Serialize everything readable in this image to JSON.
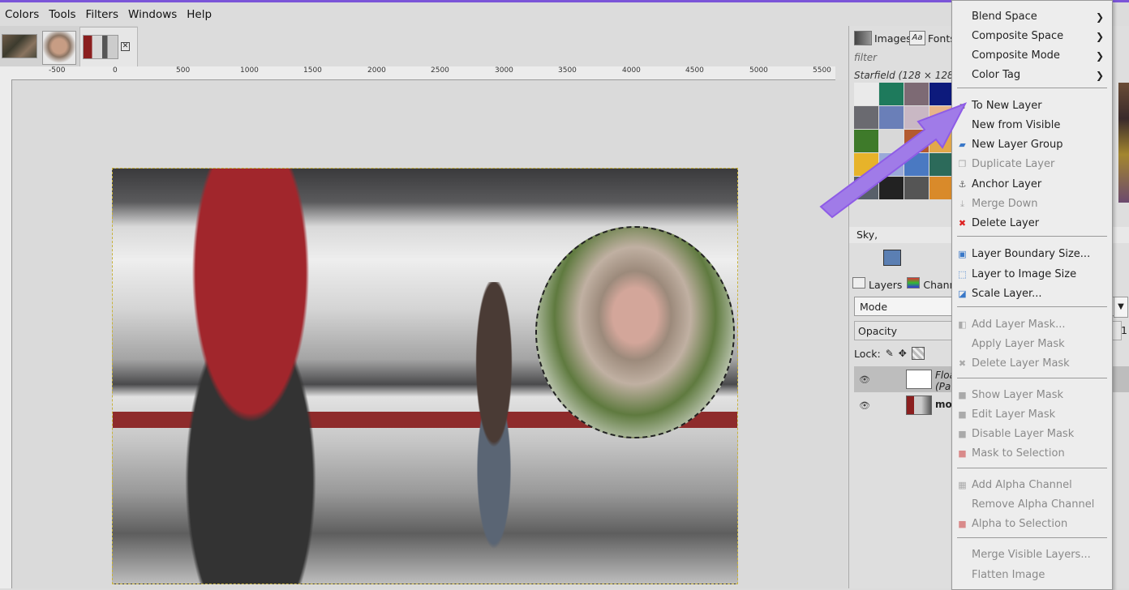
{
  "menubar": {
    "items": [
      "Colors",
      "Tools",
      "Filters",
      "Windows",
      "Help"
    ]
  },
  "image_tabs": {
    "close_glyph": "✕"
  },
  "ruler": {
    "h_labels": [
      "-500",
      "0",
      "500",
      "1000",
      "1500",
      "2000",
      "2500",
      "3000",
      "3500",
      "4000",
      "4500",
      "5000",
      "5500"
    ]
  },
  "dock": {
    "tabs": {
      "images": "Images",
      "fonts": "Fonts",
      "fonts_icon_glyph": "Aa"
    },
    "filter_placeholder": "filter",
    "pattern_name": "Starfield (128 × 128)",
    "pattern_colors": [
      "#eaeaea",
      "#1e7a5c",
      "#7d6a74",
      "#0d1a7c",
      "#6a6a70",
      "#6a7fb8",
      "#c9b8c4",
      "#e7b48a",
      "#3e7a2a",
      "#d8d8d8",
      "#b35a2f",
      "#e2a84a",
      "#e7b32a",
      "#9aa9d8",
      "#4a79c2",
      "#2c6a5a",
      "#58606a",
      "#222222",
      "#555555",
      "#d98a2a"
    ],
    "brush_name": "Sky,",
    "layers_tab": "Layers",
    "channels_tab": "Channe",
    "mode_label": "Mode",
    "opacity_label": "Opacity",
    "opacity_value": "1",
    "lock_label": "Lock:",
    "layer1_name_a": "Floa",
    "layer1_name_b": "(Pa",
    "layer2_name": "mo"
  },
  "context_menu": {
    "items": [
      {
        "label": "Blend Space",
        "submenu": true,
        "enabled": true
      },
      {
        "label": "Composite Space",
        "submenu": true,
        "enabled": true
      },
      {
        "label": "Composite Mode",
        "submenu": true,
        "enabled": true
      },
      {
        "label": "Color Tag",
        "submenu": true,
        "enabled": true
      },
      {
        "label": "To New Layer",
        "icon": "new-layer-icon",
        "enabled": true
      },
      {
        "label": "New from Visible",
        "enabled": true
      },
      {
        "label": "New Layer Group",
        "icon": "layer-group-icon",
        "enabled": true
      },
      {
        "label": "Duplicate Layer",
        "icon": "duplicate-icon",
        "enabled": false
      },
      {
        "label": "Anchor Layer",
        "icon": "anchor-icon",
        "enabled": true
      },
      {
        "label": "Merge Down",
        "icon": "merge-down-icon",
        "enabled": false
      },
      {
        "label": "Delete Layer",
        "icon": "delete-icon",
        "enabled": true
      },
      {
        "label": "Layer Boundary Size...",
        "icon": "boundary-size-icon",
        "enabled": true
      },
      {
        "label": "Layer to Image Size",
        "icon": "image-size-icon",
        "enabled": true
      },
      {
        "label": "Scale Layer...",
        "icon": "scale-icon",
        "enabled": true
      },
      {
        "label": "Add Layer Mask...",
        "icon": "add-mask-icon",
        "enabled": false
      },
      {
        "label": "Apply Layer Mask",
        "enabled": false
      },
      {
        "label": "Delete Layer Mask",
        "icon": "delete-mask-icon",
        "enabled": false
      },
      {
        "label": "Show Layer Mask",
        "icon": "checkbox-icon",
        "enabled": false
      },
      {
        "label": "Edit Layer Mask",
        "icon": "checkbox-icon",
        "enabled": false
      },
      {
        "label": "Disable Layer Mask",
        "icon": "checkbox-icon",
        "enabled": false
      },
      {
        "label": "Mask to Selection",
        "icon": "mask-selection-icon",
        "enabled": false
      },
      {
        "label": "Add Alpha Channel",
        "icon": "alpha-icon",
        "enabled": false
      },
      {
        "label": "Remove Alpha Channel",
        "enabled": false
      },
      {
        "label": "Alpha to Selection",
        "icon": "alpha-selection-icon",
        "enabled": false
      },
      {
        "label": "Merge Visible Layers...",
        "enabled": false
      },
      {
        "label": "Flatten Image",
        "enabled": false
      }
    ]
  },
  "colors": {
    "accent": "#8e5ce6",
    "selection_border": "#c8b23c"
  }
}
